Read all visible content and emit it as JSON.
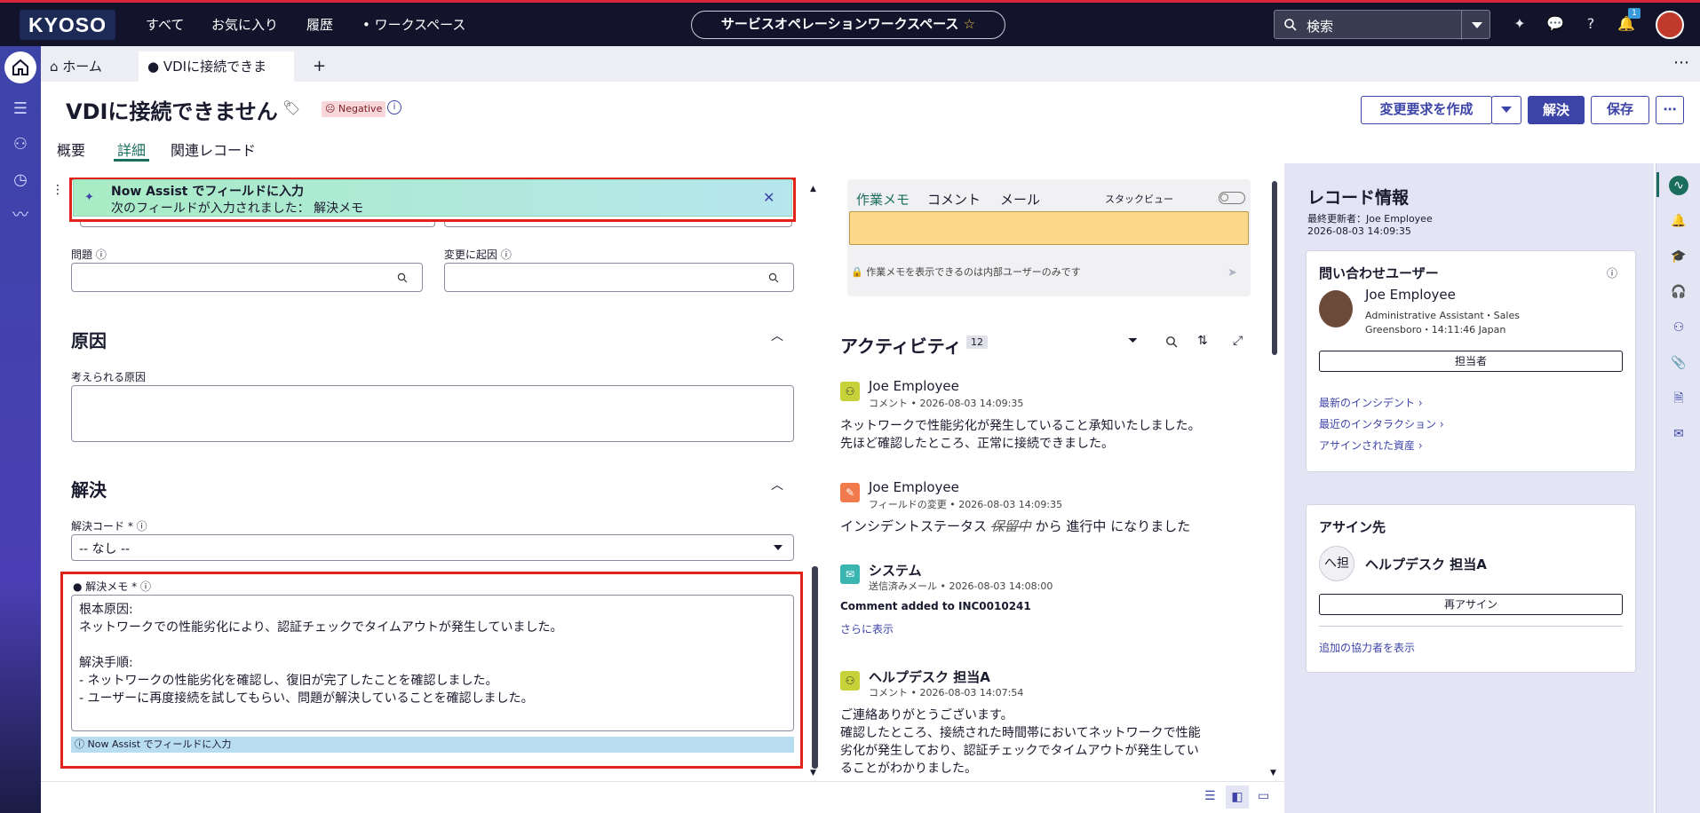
{
  "topbar": {
    "logo": "KYOSO",
    "nav": [
      "すべて",
      "お気に入り",
      "履歴",
      "ワークスペース"
    ],
    "workspace": "サービスオペレーションワークスペース",
    "search_placeholder": "検索",
    "notif_count": "1"
  },
  "tabs": {
    "home": "ホーム",
    "current": "VDIに接続できま",
    "add": "+"
  },
  "header": {
    "title": "VDIに接続できません",
    "sentiment": "Negative",
    "btn_change": "変更要求を作成",
    "btn_resolve": "解決",
    "btn_save": "保存",
    "tabs": [
      "概要",
      "詳細",
      "関連レコード"
    ]
  },
  "form": {
    "banner_title": "Now Assist でフィールドに入力",
    "banner_sub": "次のフィールドが入力されました： 解決メモ",
    "problem_label": "問題",
    "change_label": "変更に起因",
    "cause_section": "原因",
    "cause_label": "考えられる原因",
    "resolve_section": "解決",
    "res_code_label": "解決コード *",
    "res_code_value": "-- なし --",
    "res_note_label": "解決メモ *",
    "res_note_lines": [
      "根本原因:",
      "ネットワークでの性能劣化により、認証チェックでタイムアウトが発生していました。",
      "",
      "解決手順:",
      "- ネットワークの性能劣化を確認し、復旧が完了したことを確認しました。",
      "- ユーザーに再度接続を試してもらい、問題が解決していることを確認しました。"
    ],
    "assist_tag": "Now Assist でフィールドに入力"
  },
  "compose": {
    "tabs": [
      "作業メモ",
      "コメント",
      "メール"
    ],
    "stack_view": "スタックビュー",
    "hint": "作業メモを表示できるのは内部ユーザーのみです"
  },
  "activity": {
    "title": "アクティビティ",
    "count": "12",
    "items": [
      {
        "author": "Joe Employee",
        "type": "コメント",
        "time": "2026-08-03 14:09:35",
        "body": "ネットワークで性能劣化が発生していること承知いたしました。\n先ほど確認したところ、正常に接続できました。"
      },
      {
        "author": "Joe Employee",
        "type": "フィールドの変更",
        "time": "2026-08-03 14:09:35",
        "body_pre": "インシデントステータス",
        "body_old": "保留中",
        "body_mid": "から",
        "body_new": "進行中",
        "body_post": "になりました"
      },
      {
        "author": "システム",
        "type": "送信済みメール",
        "time": "2026-08-03 14:08:00",
        "body": "Comment added to INC0010241",
        "more": "さらに表示"
      },
      {
        "author": "ヘルプデスク 担当A",
        "type": "コメント",
        "time": "2026-08-03 14:07:54",
        "body": "ご連絡ありがとうございます。\n確認したところ、接続された時間帯においてネットワークで性能\n劣化が発生しており、認証チェックでタイムアウトが発生してい\nることがわかりました。"
      }
    ]
  },
  "record": {
    "title": "レコード情報",
    "updated_by": "最終更新者：Joe Employee",
    "updated_at": "2026-08-03 14:09:35",
    "caller_title": "問い合わせユーザー",
    "caller_name": "Joe Employee",
    "caller_role": "Administrative Assistant・Sales",
    "caller_loc": "Greensboro・14:11:46 Japan",
    "assignee_btn": "担当者",
    "links": [
      "最新のインシデント",
      "最近のインタラクション",
      "アサインされた資産"
    ],
    "assign_title": "アサイン先",
    "assign_initial": "へ担",
    "assign_name": "ヘルプデスク 担当A",
    "reassign": "再アサイン",
    "collab": "追加の協力者を表示"
  },
  "colors": {
    "accent": "#3d44a8",
    "topbar": "#13142b",
    "highlight": "#e2231a"
  }
}
